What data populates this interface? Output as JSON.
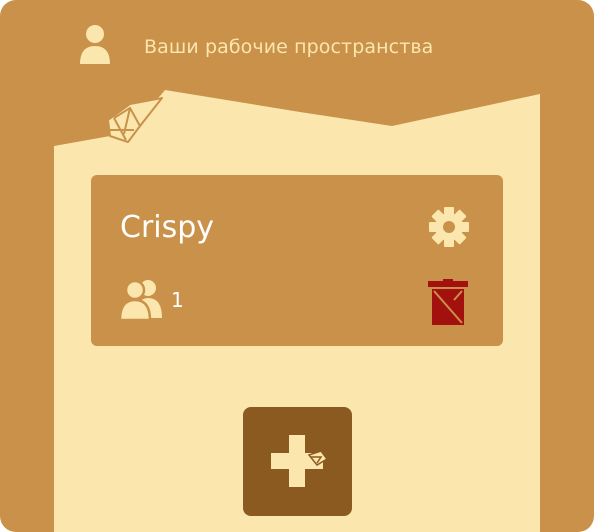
{
  "header": {
    "title": "Ваши рабочие пространства",
    "user_icon": "user-icon"
  },
  "workspaces": [
    {
      "name": "Crispy",
      "members_count": "1",
      "settings_icon": "gear-icon",
      "members_icon": "users-icon",
      "delete_icon": "trash-icon"
    }
  ],
  "add_button": {
    "icon": "plus-icon"
  },
  "colors": {
    "background": "#c9914a",
    "paper": "#fbe6ad",
    "card": "#c9914a",
    "card_text": "#ffffff",
    "delete": "#a3110f",
    "add_button": "#8a5a20"
  }
}
